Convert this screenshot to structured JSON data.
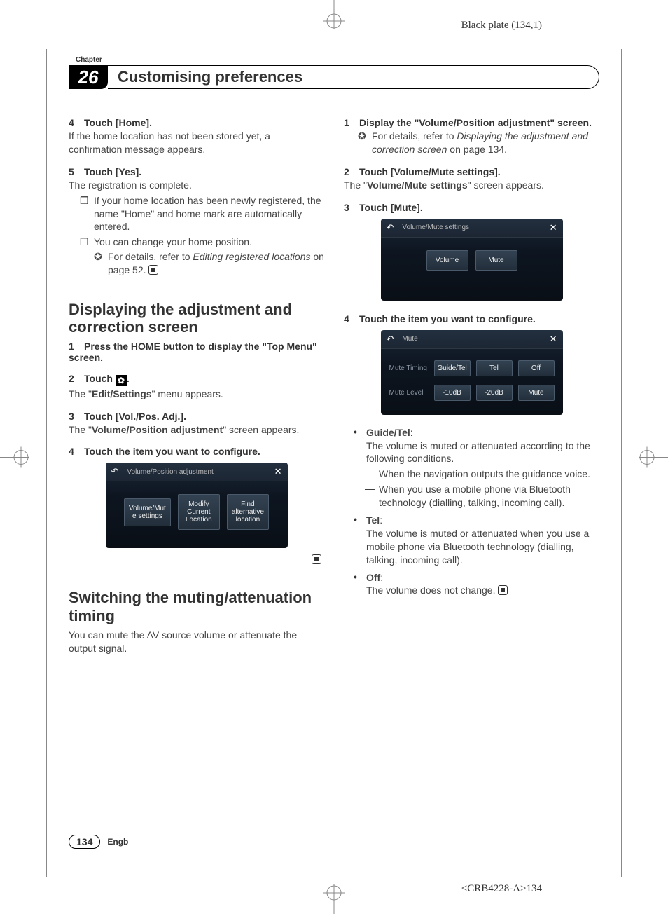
{
  "meta": {
    "black_plate": "Black plate (134,1)",
    "doc_id": "<CRB4228-A>134"
  },
  "header": {
    "chapter_label": "Chapter",
    "chapter_num": "26",
    "chapter_title": "Customising preferences"
  },
  "left": {
    "s4": {
      "heading_num": "4",
      "heading": "Touch [Home].",
      "body": "If the home location has not been stored yet, a confirmation message appears."
    },
    "s5": {
      "heading_num": "5",
      "heading": "Touch [Yes].",
      "body": "The registration is complete.",
      "note1": "If your home location has been newly registered, the name \"Home\" and home mark are automatically entered.",
      "note2": "You can change your home position.",
      "xref_prefix": "For details, refer to ",
      "xref_italic": "Editing registered locations",
      "xref_suffix": " on page 52."
    },
    "sec_display": {
      "title": "Displaying the adjustment and correction screen",
      "s1_num": "1",
      "s1": "Press the HOME button to display the \"Top Menu\" screen.",
      "s2_num": "2",
      "s2_prefix": "Touch ",
      "s2_suffix": ".",
      "s2_body_pre": "The \"",
      "s2_body_bold": "Edit/Settings",
      "s2_body_post": "\" menu appears.",
      "s3_num": "3",
      "s3": "Touch [Vol./Pos. Adj.].",
      "s3_body_pre": "The \"",
      "s3_body_bold": "Volume/Position adjustment",
      "s3_body_post": "\" screen appears.",
      "s4_num": "4",
      "s4": "Touch the item you want to configure."
    },
    "screenshot1": {
      "title": "Volume/Position adjustment",
      "btn1": "Volume/Mut\ne settings",
      "btn2": "Modify\nCurrent\nLocation",
      "btn3": "Find\nalternative\nlocation"
    },
    "sec_switch": {
      "title": "Switching the muting/attenuation timing",
      "intro": "You can mute the AV source volume or attenuate the output signal."
    }
  },
  "right": {
    "s1": {
      "num": "1",
      "text": "Display the \"Volume/Position adjustment\" screen.",
      "xref_prefix": "For details, refer to ",
      "xref_italic": "Displaying the adjustment and correction screen",
      "xref_suffix": " on page 134."
    },
    "s2": {
      "num": "2",
      "text": "Touch [Volume/Mute settings].",
      "body_pre": "The \"",
      "body_bold": "Volume/Mute settings",
      "body_post": "\" screen appears."
    },
    "s3": {
      "num": "3",
      "text": "Touch [Mute]."
    },
    "screenshot2": {
      "title": "Volume/Mute settings",
      "btn1": "Volume",
      "btn2": "Mute"
    },
    "s4": {
      "num": "4",
      "text": "Touch the item you want to configure."
    },
    "screenshot3": {
      "title": "Mute",
      "row1_label": "Mute Timing",
      "row1_b1": "Guide/Tel",
      "row1_b2": "Tel",
      "row1_b3": "Off",
      "row2_label": "Mute Level",
      "row2_b1": "-10dB",
      "row2_b2": "-20dB",
      "row2_b3": "Mute"
    },
    "bullets": {
      "guide_label": "Guide/Tel",
      "guide_text": "The volume is muted or attenuated according to the following conditions.",
      "guide_d1": "When the navigation outputs the guidance voice.",
      "guide_d2": "When you use a mobile phone via Bluetooth technology (dialling, talking, incoming call).",
      "tel_label": "Tel",
      "tel_text": "The volume is muted or attenuated when you use a mobile phone via Bluetooth technology (dialling, talking, incoming call).",
      "off_label": "Off",
      "off_text": "The volume does not change."
    }
  },
  "footer": {
    "page_num": "134",
    "lang": "Engb"
  }
}
